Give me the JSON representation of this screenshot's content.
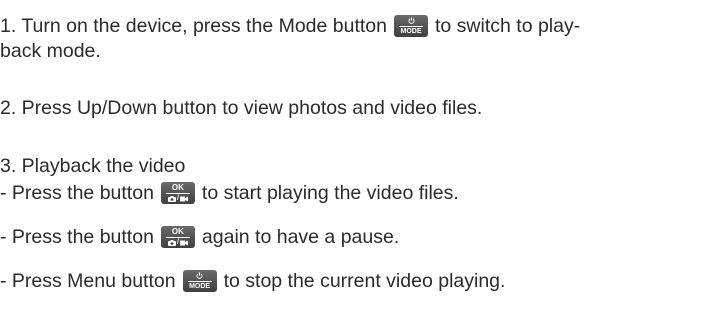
{
  "instructions": {
    "step1": {
      "before": "1. Turn on the device, press the Mode button",
      "after": "to switch to play-",
      "cont": "back mode.",
      "button_label": "MODE"
    },
    "step2": {
      "text": "2. Press Up/Down button to view photos and video files."
    },
    "step3": {
      "heading": "3. Playback the video",
      "bullet1": {
        "before": "- Press the button",
        "after": "to start playing the video files.",
        "button_top": "OK"
      },
      "bullet2": {
        "before": "- Press the button",
        "after": "again to have a pause.",
        "button_top": "OK"
      },
      "bullet3": {
        "before": "- Press Menu button",
        "after": "to stop the current video playing.",
        "button_label": "MODE"
      }
    }
  },
  "icons": {
    "mode_button": "power-mode-button-icon",
    "ok_button": "ok-camera-video-button-icon"
  },
  "colors": {
    "text": "#2b2b2b",
    "button_bg": "#4a4a4a"
  }
}
